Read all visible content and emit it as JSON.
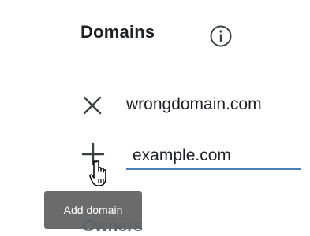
{
  "domains_section": {
    "title": "Domains",
    "info_icon": "info-icon",
    "existing_domains": [
      {
        "name": "wrongdomain.com",
        "action_icon": "close-icon"
      }
    ],
    "new_domain": {
      "value": "example.com",
      "action_icon": "add-icon",
      "accent_color": "#4a7fb5"
    },
    "tooltip": "Add domain"
  },
  "next_section": {
    "title_partial": "Owners"
  },
  "cursor": "hand-pointer-icon"
}
